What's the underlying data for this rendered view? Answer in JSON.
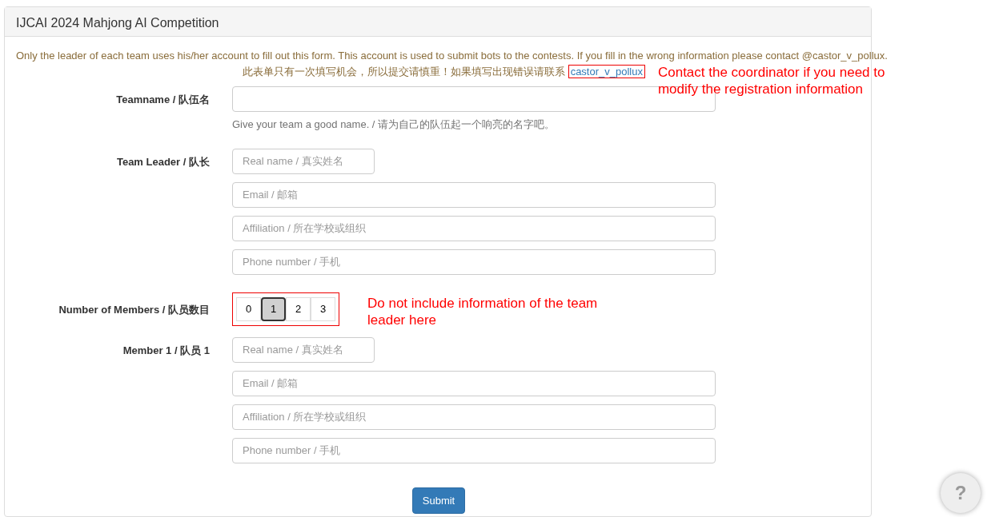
{
  "panel_title": "IJCAI 2024 Mahjong AI Competition",
  "intro": {
    "text": "Only the leader of each team uses his/her account to fill out this form. This account is used to submit bots to the contests. If you fill in the wrong information please contact @castor_v_pollux.",
    "text_zh": "此表单只有一次填写机会，所以提交请慎重！如果填写出现错误请联系",
    "link": "castor_v_pollux",
    "note": "Contact the coordinator if you need to modify the registration information"
  },
  "sections": [
    {
      "kind": "text",
      "label": "Teamname / 队伍名",
      "inputs": [
        {
          "wide": true
        }
      ],
      "help": "Give your team a good name. / 请为自己的队伍起一个响亮的名字吧。"
    },
    {
      "kind": "text",
      "label": "Team Leader / 队长",
      "inputs": [
        {
          "placeholder": "Real name / 真实姓名",
          "wide": false
        },
        {
          "placeholder": "Email / 邮箱",
          "wide": true
        },
        {
          "placeholder": "Affiliation / 所在学校或组织",
          "wide": true
        },
        {
          "placeholder": "Phone number / 手机",
          "wide": true
        }
      ]
    },
    {
      "kind": "choice",
      "label": "Number of Members / 队员数目",
      "options": [
        {
          "label": "0",
          "selected": false
        },
        {
          "label": "1",
          "selected": true
        },
        {
          "label": "2",
          "selected": false
        },
        {
          "label": "3",
          "selected": false
        }
      ],
      "note": "Do not include information of the team leader here"
    },
    {
      "kind": "text",
      "label": "Member 1 / 队员 1",
      "inputs": [
        {
          "placeholder": "Real name / 真实姓名",
          "wide": false
        },
        {
          "placeholder": "Email / 邮箱",
          "wide": true
        },
        {
          "placeholder": "Affiliation / 所在学校或组织",
          "wide": true
        },
        {
          "placeholder": "Phone number / 手机",
          "wide": true
        }
      ]
    }
  ],
  "submit": "Submit",
  "help_button": "?"
}
